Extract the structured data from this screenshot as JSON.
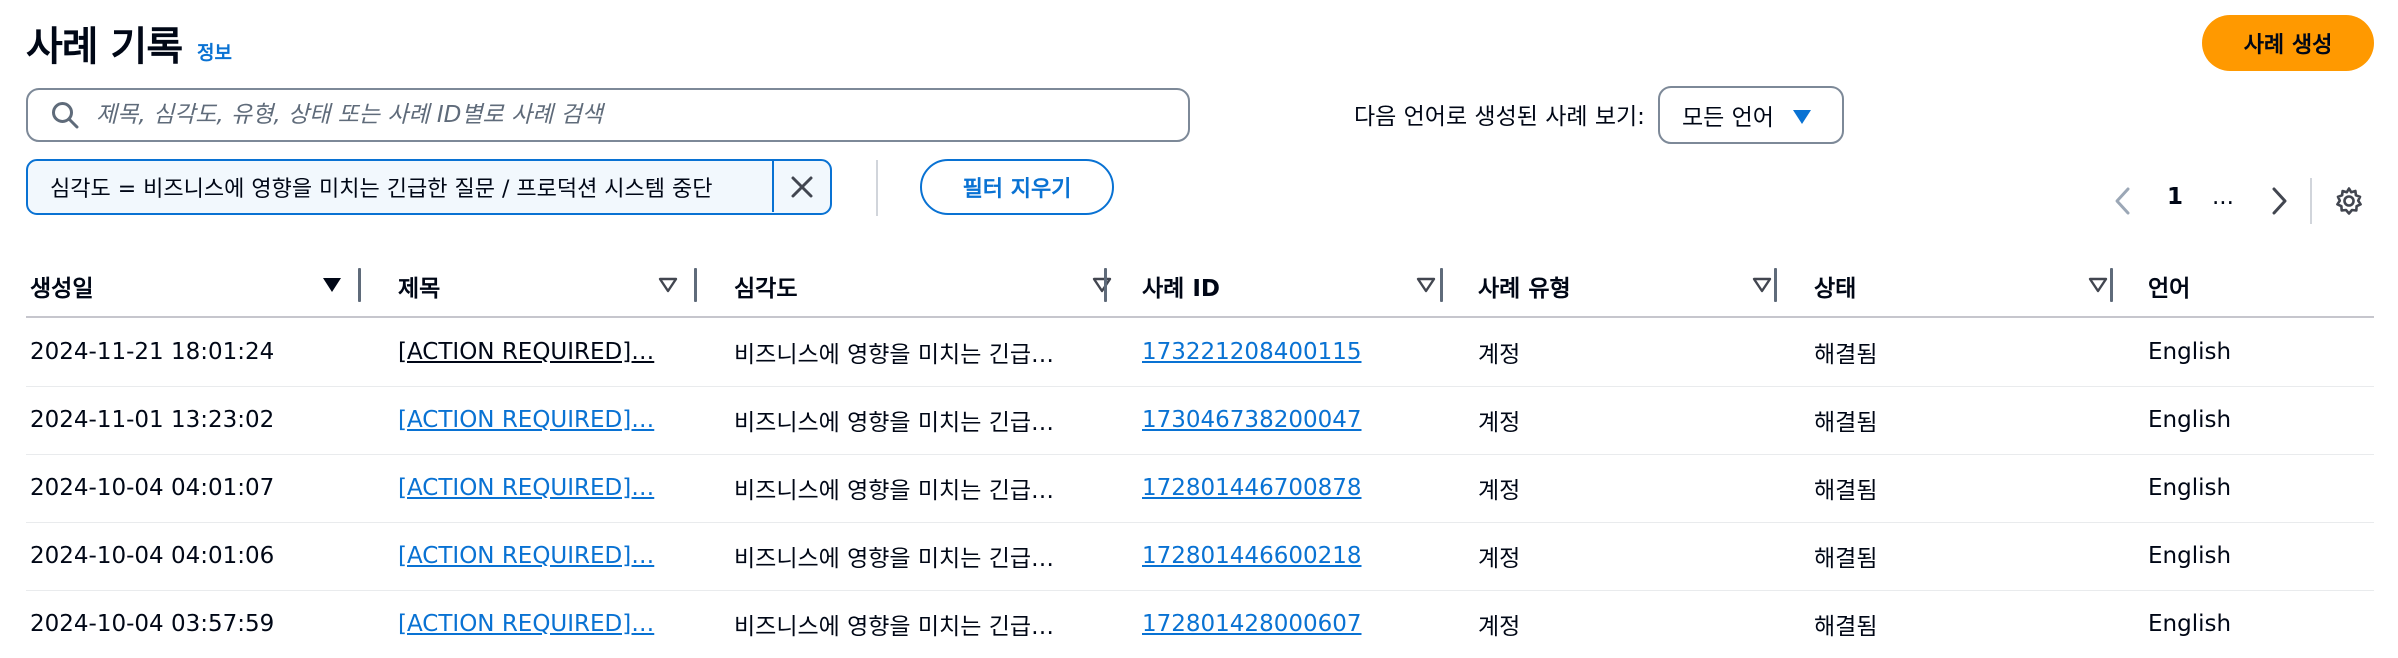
{
  "header": {
    "title": "사례 기록",
    "info_link": "정보",
    "create_button": "사례 생성"
  },
  "search": {
    "placeholder": "제목, 심각도, 유형, 상태 또는 사례 ID별로 사례 검색",
    "value": ""
  },
  "language_filter": {
    "label": "다음 언어로 생성된 사례 보기:",
    "selected": "모든 언어"
  },
  "filter_token": {
    "text": "심각도 = 비즈니스에 영향을 미치는 긴급한 질문 / 프로덕션 시스템 중단"
  },
  "clear_filters_button": "필터 지우기",
  "pagination": {
    "current_page": "1",
    "ellipsis": "..."
  },
  "table": {
    "columns": [
      {
        "label": "생성일",
        "sorted": true
      },
      {
        "label": "제목",
        "sorted": false
      },
      {
        "label": "심각도",
        "sorted": false
      },
      {
        "label": "사례 ID",
        "sorted": false
      },
      {
        "label": "사례 유형",
        "sorted": false
      },
      {
        "label": "상태",
        "sorted": false
      },
      {
        "label": "언어",
        "sorted": false
      }
    ],
    "rows": [
      {
        "created": "2024-11-21 18:01:24",
        "title": "[ACTION REQUIRED]…",
        "severity": "비즈니스에 영향을 미치는 긴급…",
        "case_id": "173221208400115",
        "type": "계정",
        "status": "해결됨",
        "language": "English"
      },
      {
        "created": "2024-11-01 13:23:02",
        "title": "[ACTION REQUIRED]…",
        "severity": "비즈니스에 영향을 미치는 긴급…",
        "case_id": "173046738200047",
        "type": "계정",
        "status": "해결됨",
        "language": "English"
      },
      {
        "created": "2024-10-04 04:01:07",
        "title": "[ACTION REQUIRED]…",
        "severity": "비즈니스에 영향을 미치는 긴급…",
        "case_id": "172801446700878",
        "type": "계정",
        "status": "해결됨",
        "language": "English"
      },
      {
        "created": "2024-10-04 04:01:06",
        "title": "[ACTION REQUIRED]…",
        "severity": "비즈니스에 영향을 미치는 긴급…",
        "case_id": "172801446600218",
        "type": "계정",
        "status": "해결됨",
        "language": "English"
      },
      {
        "created": "2024-10-04 03:57:59",
        "title": "[ACTION REQUIRED]…",
        "severity": "비즈니스에 영향을 미치는 긴급…",
        "case_id": "172801428000607",
        "type": "계정",
        "status": "해결됨",
        "language": "English"
      }
    ]
  },
  "icons": {
    "search": "search-icon",
    "caret": "caret-down-icon",
    "close": "close-icon",
    "prev": "chevron-left-icon",
    "next": "chevron-right-icon",
    "settings": "gear-icon",
    "sort": "sort-icon"
  },
  "colors": {
    "accent": "#ff9900",
    "link": "#0972d3",
    "text": "#000716",
    "border": "#7d8998"
  }
}
